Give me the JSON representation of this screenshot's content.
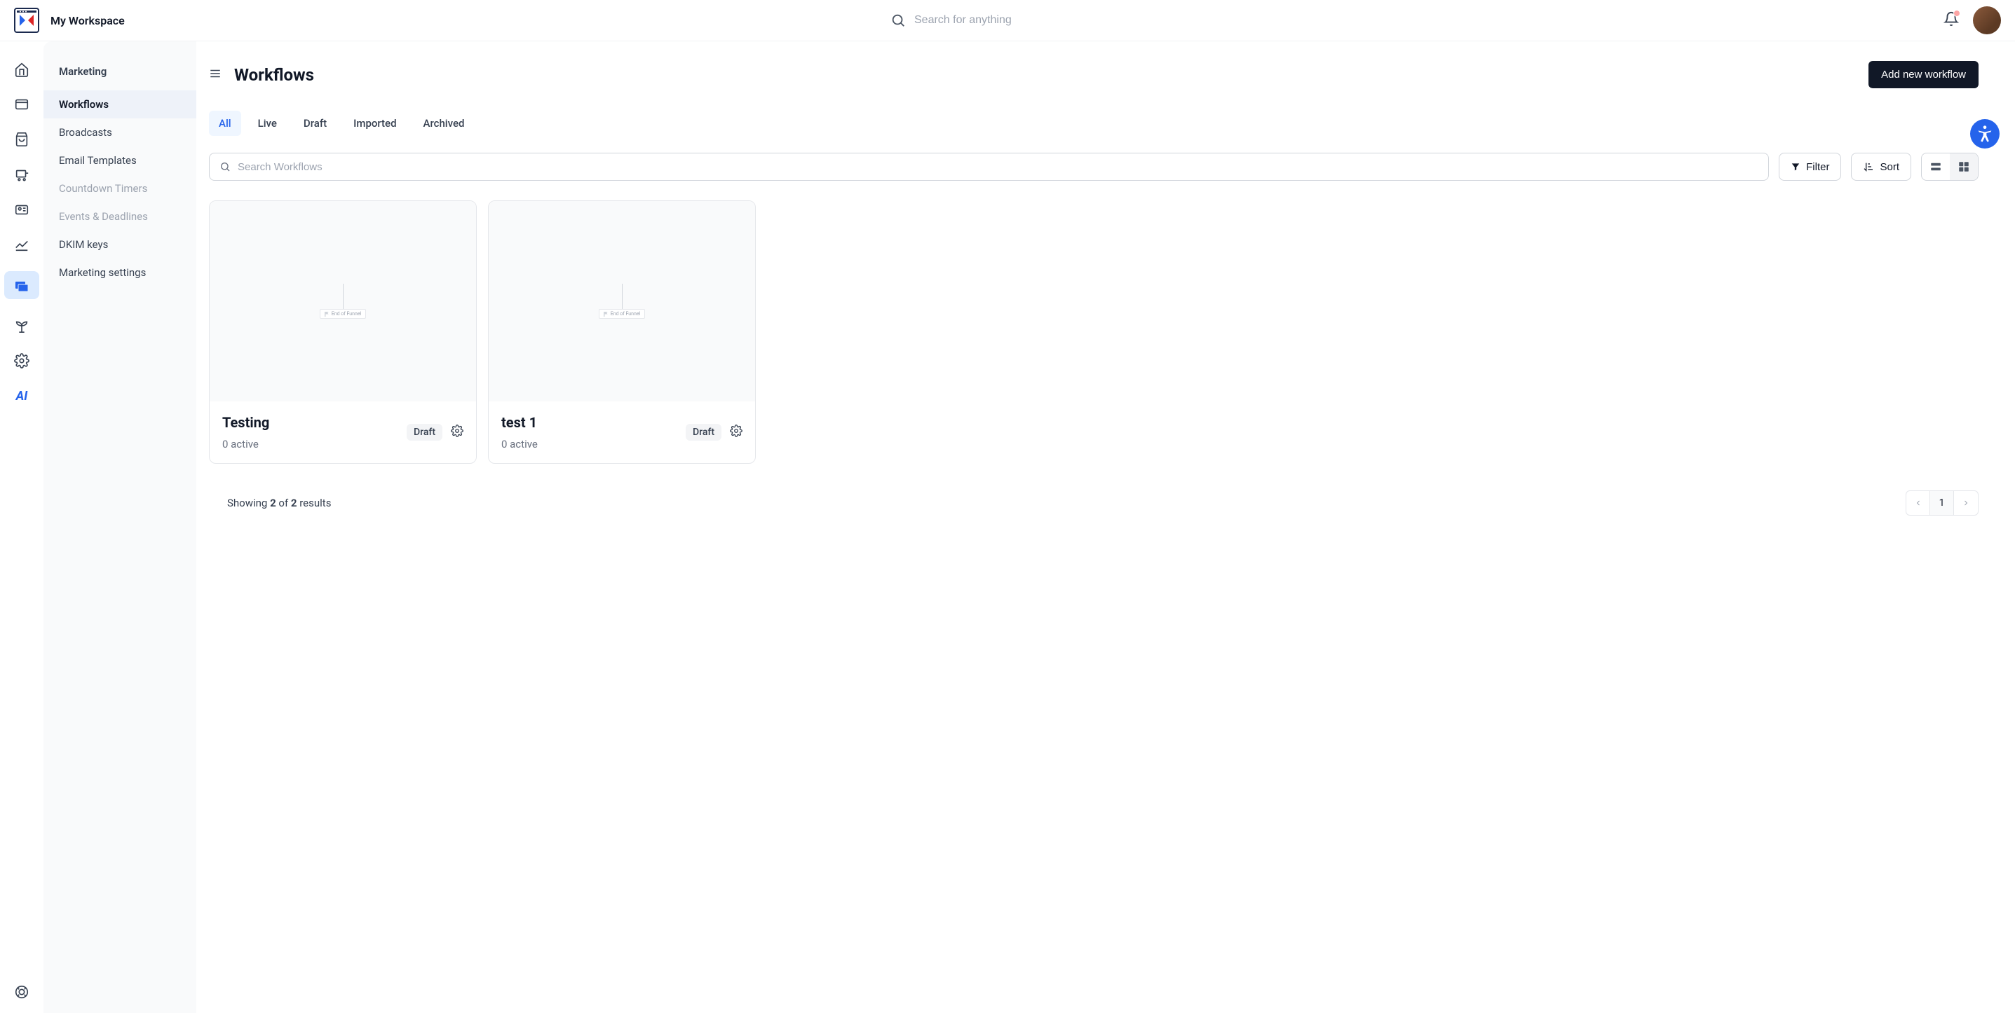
{
  "header": {
    "workspace_name": "My Workspace",
    "search_placeholder": "Search for anything"
  },
  "icon_rail": [
    {
      "name": "home-icon"
    },
    {
      "name": "window-icon"
    },
    {
      "name": "shopping-bag-icon"
    },
    {
      "name": "cart-icon"
    },
    {
      "name": "contact-card-icon"
    },
    {
      "name": "analytics-icon"
    },
    {
      "name": "email-icon",
      "active": true
    },
    {
      "name": "plant-icon"
    },
    {
      "name": "settings-icon"
    },
    {
      "name": "ai-icon"
    }
  ],
  "sidebar": {
    "title": "Marketing",
    "items": [
      {
        "label": "Workflows",
        "active": true,
        "disabled": false
      },
      {
        "label": "Broadcasts",
        "active": false,
        "disabled": false
      },
      {
        "label": "Email Templates",
        "active": false,
        "disabled": false
      },
      {
        "label": "Countdown Timers",
        "active": false,
        "disabled": true
      },
      {
        "label": "Events & Deadlines",
        "active": false,
        "disabled": true
      },
      {
        "label": "DKIM keys",
        "active": false,
        "disabled": false
      },
      {
        "label": "Marketing settings",
        "active": false,
        "disabled": false
      }
    ]
  },
  "page": {
    "title": "Workflows",
    "add_button": "Add new workflow",
    "tabs": [
      {
        "label": "All",
        "active": true
      },
      {
        "label": "Live",
        "active": false
      },
      {
        "label": "Draft",
        "active": false
      },
      {
        "label": "Imported",
        "active": false
      },
      {
        "label": "Archived",
        "active": false
      }
    ],
    "search_placeholder": "Search Workflows",
    "filter_label": "Filter",
    "sort_label": "Sort",
    "preview_pill_label": "End of Funnel",
    "cards": [
      {
        "title": "Testing",
        "active_text": "0 active",
        "status": "Draft"
      },
      {
        "title": "test 1",
        "active_text": "0 active",
        "status": "Draft"
      }
    ],
    "results_prefix": "Showing ",
    "results_count": "2",
    "results_mid": " of ",
    "results_total": "2",
    "results_suffix": " results",
    "pagination": {
      "current": "1"
    }
  }
}
